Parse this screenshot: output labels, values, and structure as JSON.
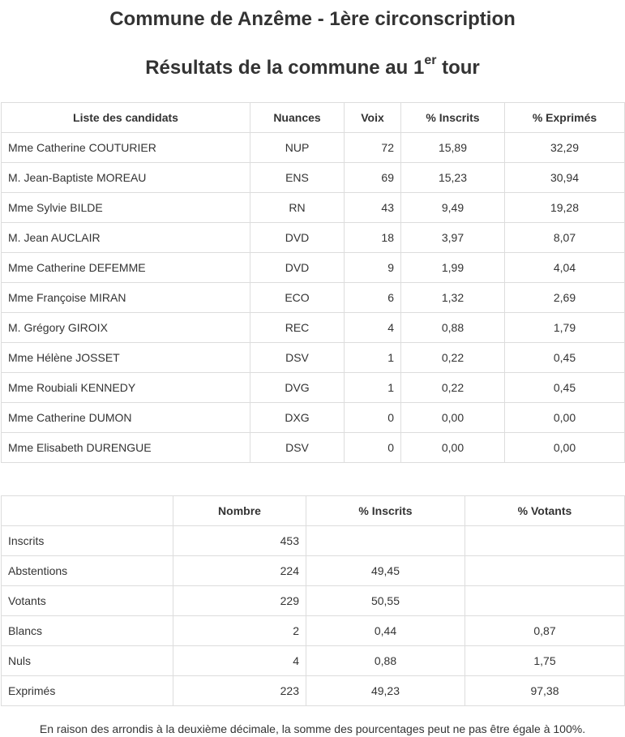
{
  "title_line1": "Commune de Anzême - 1ère circonscription",
  "title_line2": {
    "before": "Résultats de la commune au 1",
    "sup": "er",
    "after": " tour"
  },
  "candidates_table": {
    "headers": [
      "Liste des candidats",
      "Nuances",
      "Voix",
      "% Inscrits",
      "% Exprimés"
    ],
    "rows": [
      {
        "name": "Mme Catherine COUTURIER",
        "nuance": "NUP",
        "voix": "72",
        "inscrits": "15,89",
        "exprimes": "32,29"
      },
      {
        "name": "M. Jean-Baptiste MOREAU",
        "nuance": "ENS",
        "voix": "69",
        "inscrits": "15,23",
        "exprimes": "30,94"
      },
      {
        "name": "Mme Sylvie BILDE",
        "nuance": "RN",
        "voix": "43",
        "inscrits": "9,49",
        "exprimes": "19,28"
      },
      {
        "name": "M. Jean AUCLAIR",
        "nuance": "DVD",
        "voix": "18",
        "inscrits": "3,97",
        "exprimes": "8,07"
      },
      {
        "name": "Mme Catherine DEFEMME",
        "nuance": "DVD",
        "voix": "9",
        "inscrits": "1,99",
        "exprimes": "4,04"
      },
      {
        "name": "Mme Françoise MIRAN",
        "nuance": "ECO",
        "voix": "6",
        "inscrits": "1,32",
        "exprimes": "2,69"
      },
      {
        "name": "M. Grégory GIROIX",
        "nuance": "REC",
        "voix": "4",
        "inscrits": "0,88",
        "exprimes": "1,79"
      },
      {
        "name": "Mme Hélène JOSSET",
        "nuance": "DSV",
        "voix": "1",
        "inscrits": "0,22",
        "exprimes": "0,45"
      },
      {
        "name": "Mme Roubiali KENNEDY",
        "nuance": "DVG",
        "voix": "1",
        "inscrits": "0,22",
        "exprimes": "0,45"
      },
      {
        "name": "Mme Catherine DUMON",
        "nuance": "DXG",
        "voix": "0",
        "inscrits": "0,00",
        "exprimes": "0,00"
      },
      {
        "name": "Mme Elisabeth DURENGUE",
        "nuance": "DSV",
        "voix": "0",
        "inscrits": "0,00",
        "exprimes": "0,00"
      }
    ]
  },
  "summary_table": {
    "headers": [
      "",
      "Nombre",
      "% Inscrits",
      "% Votants"
    ],
    "rows": [
      {
        "label": "Inscrits",
        "nombre": "453",
        "inscrits": "",
        "votants": ""
      },
      {
        "label": "Abstentions",
        "nombre": "224",
        "inscrits": "49,45",
        "votants": ""
      },
      {
        "label": "Votants",
        "nombre": "229",
        "inscrits": "50,55",
        "votants": ""
      },
      {
        "label": "Blancs",
        "nombre": "2",
        "inscrits": "0,44",
        "votants": "0,87"
      },
      {
        "label": "Nuls",
        "nombre": "4",
        "inscrits": "0,88",
        "votants": "1,75"
      },
      {
        "label": "Exprimés",
        "nombre": "223",
        "inscrits": "49,23",
        "votants": "97,38"
      }
    ]
  },
  "footnote": "En raison des arrondis à la deuxième décimale, la somme des pourcentages peut ne pas être égale à 100%."
}
